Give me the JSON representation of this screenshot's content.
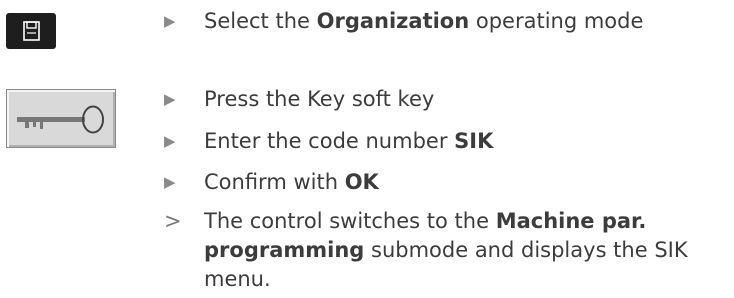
{
  "icons": {
    "organization_softkey": "floppy-disk-icon",
    "key_softkey": "key-icon"
  },
  "step_organization": {
    "pre": "Select the ",
    "bold": "Organization",
    "post": " operating mode"
  },
  "step_key": {
    "text": "Press the Key soft key"
  },
  "step_code": {
    "pre": "Enter the code number ",
    "bold": "SIK"
  },
  "step_confirm": {
    "pre": "Confirm with ",
    "bold": "OK"
  },
  "result": {
    "line1_pre": "The control switches to the ",
    "line1_bold": "Machine par.",
    "line2_bold": "programming",
    "line2_post": " submode and displays the SIK",
    "line3": "menu."
  },
  "markers": {
    "step": "▶",
    "result": ">"
  },
  "colors": {
    "text": "#3c3c3c",
    "marker": "#8a8a8a",
    "softkey_dark": "#1e1e1e",
    "softkey_light": "#d9d9d9"
  }
}
